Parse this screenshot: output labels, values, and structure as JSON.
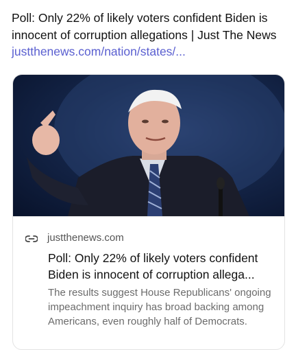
{
  "post": {
    "text": "Poll: Only 22% of likely voters confident Biden is innocent of corruption allegations | Just The News ",
    "link": "justthenews.com/nation/states/..."
  },
  "card": {
    "image_icon": "photo-of-speaker-pointing",
    "link_icon": "link-icon",
    "domain": "justthenews.com",
    "title_line1": "Poll: Only 22% of likely voters confident",
    "title_line2": "Biden is innocent of corruption allega...",
    "description": "The results suggest House Republicans' ongoing impeachment inquiry has broad backing among Americans, even roughly half of Democrats."
  }
}
